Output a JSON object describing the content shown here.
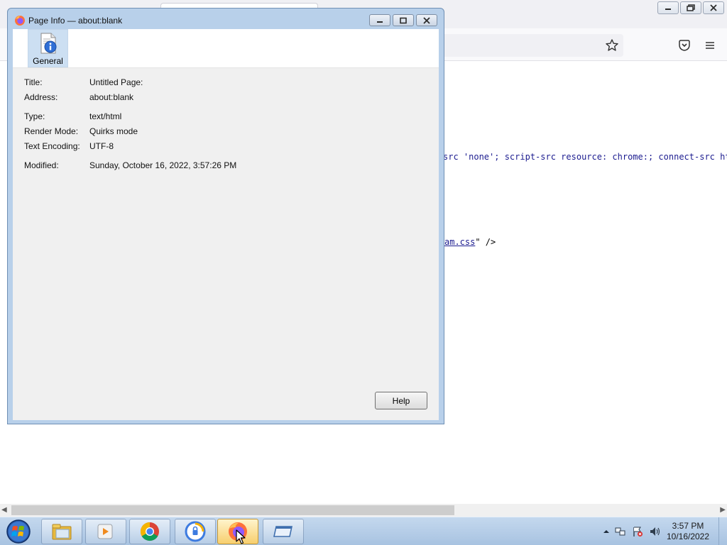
{
  "dialog": {
    "title": "Page Info — about:blank",
    "tab_general_label": "General",
    "help_label": "Help",
    "rows": [
      {
        "key": "Title:",
        "value": "Untitled Page:"
      },
      {
        "key": "Address:",
        "value": "about:blank"
      },
      {
        "key": "Type:",
        "value": "text/html"
      },
      {
        "key": "Render Mode:",
        "value": "Quirks mode"
      },
      {
        "key": "Text Encoding:",
        "value": "UTF-8"
      },
      {
        "key": "Modified:",
        "value": "Sunday, October 16, 2022, 3:57:26 PM"
      }
    ]
  },
  "browser": {
    "source_line_1": "src 'none'; script-src resource: chrome:; connect-src htt",
    "source_line_2_link": "am.css",
    "source_line_2_rest": "\" />"
  },
  "taskbar": {
    "time": "3:57 PM",
    "date": "10/16/2022",
    "items": [
      "file-explorer-icon",
      "media-player-icon",
      "chrome-icon",
      "vpn-icon",
      "firefox-icon",
      "app-window-icon"
    ]
  },
  "colors": {
    "dialog_frame": "#b8d0ea",
    "selected_tab": "#ccdff2",
    "source_text": "#1b1b8f",
    "taskbar": "#b4cde8"
  }
}
